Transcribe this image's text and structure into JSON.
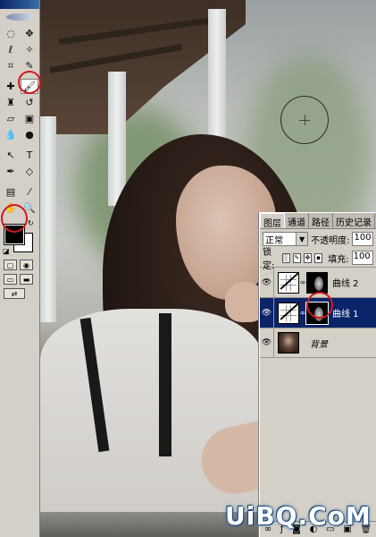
{
  "toolbox": {
    "tools": [
      {
        "name": "marquee-tool-icon",
        "glyph": "◌"
      },
      {
        "name": "move-tool-icon",
        "glyph": "✥"
      },
      {
        "name": "lasso-tool-icon",
        "glyph": "ℓ"
      },
      {
        "name": "magic-wand-tool-icon",
        "glyph": "✧"
      },
      {
        "name": "crop-tool-icon",
        "glyph": "⌗"
      },
      {
        "name": "slice-tool-icon",
        "glyph": "✎"
      },
      {
        "name": "healing-brush-tool-icon",
        "glyph": "✚"
      },
      {
        "name": "brush-tool-icon",
        "glyph": "🖌"
      },
      {
        "name": "clone-stamp-tool-icon",
        "glyph": "♜"
      },
      {
        "name": "history-brush-tool-icon",
        "glyph": "↺"
      },
      {
        "name": "eraser-tool-icon",
        "glyph": "▱"
      },
      {
        "name": "gradient-tool-icon",
        "glyph": "▣"
      },
      {
        "name": "blur-tool-icon",
        "glyph": "💧"
      },
      {
        "name": "dodge-tool-icon",
        "glyph": "●"
      },
      {
        "name": "path-selection-tool-icon",
        "glyph": "↖"
      },
      {
        "name": "type-tool-icon",
        "glyph": "T"
      },
      {
        "name": "pen-tool-icon",
        "glyph": "✒"
      },
      {
        "name": "shape-tool-icon",
        "glyph": "◇"
      },
      {
        "name": "notes-tool-icon",
        "glyph": "▤"
      },
      {
        "name": "eyedropper-tool-icon",
        "glyph": "⁄"
      },
      {
        "name": "hand-tool-icon",
        "glyph": "✋"
      },
      {
        "name": "zoom-tool-icon",
        "glyph": "🔍"
      }
    ],
    "foreground_color": "#000000",
    "background_color": "#ffffff",
    "highlight_color": "#d11a1a"
  },
  "layers_panel": {
    "tabs": [
      "图层",
      "通道",
      "路径",
      "历史记录"
    ],
    "blend_mode": "正常",
    "opacity_label": "不透明度:",
    "opacity_value": "100",
    "lock_label": "锁定:",
    "fill_label": "填充:",
    "fill_value": "100",
    "layers": [
      {
        "name": "曲线 2",
        "type": "curves",
        "selected": false,
        "visible": true
      },
      {
        "name": "曲线 1",
        "type": "curves",
        "selected": true,
        "visible": true
      },
      {
        "name": "背景",
        "type": "background",
        "selected": false,
        "visible": true
      }
    ]
  },
  "watermark": "UiBQ.CoM"
}
